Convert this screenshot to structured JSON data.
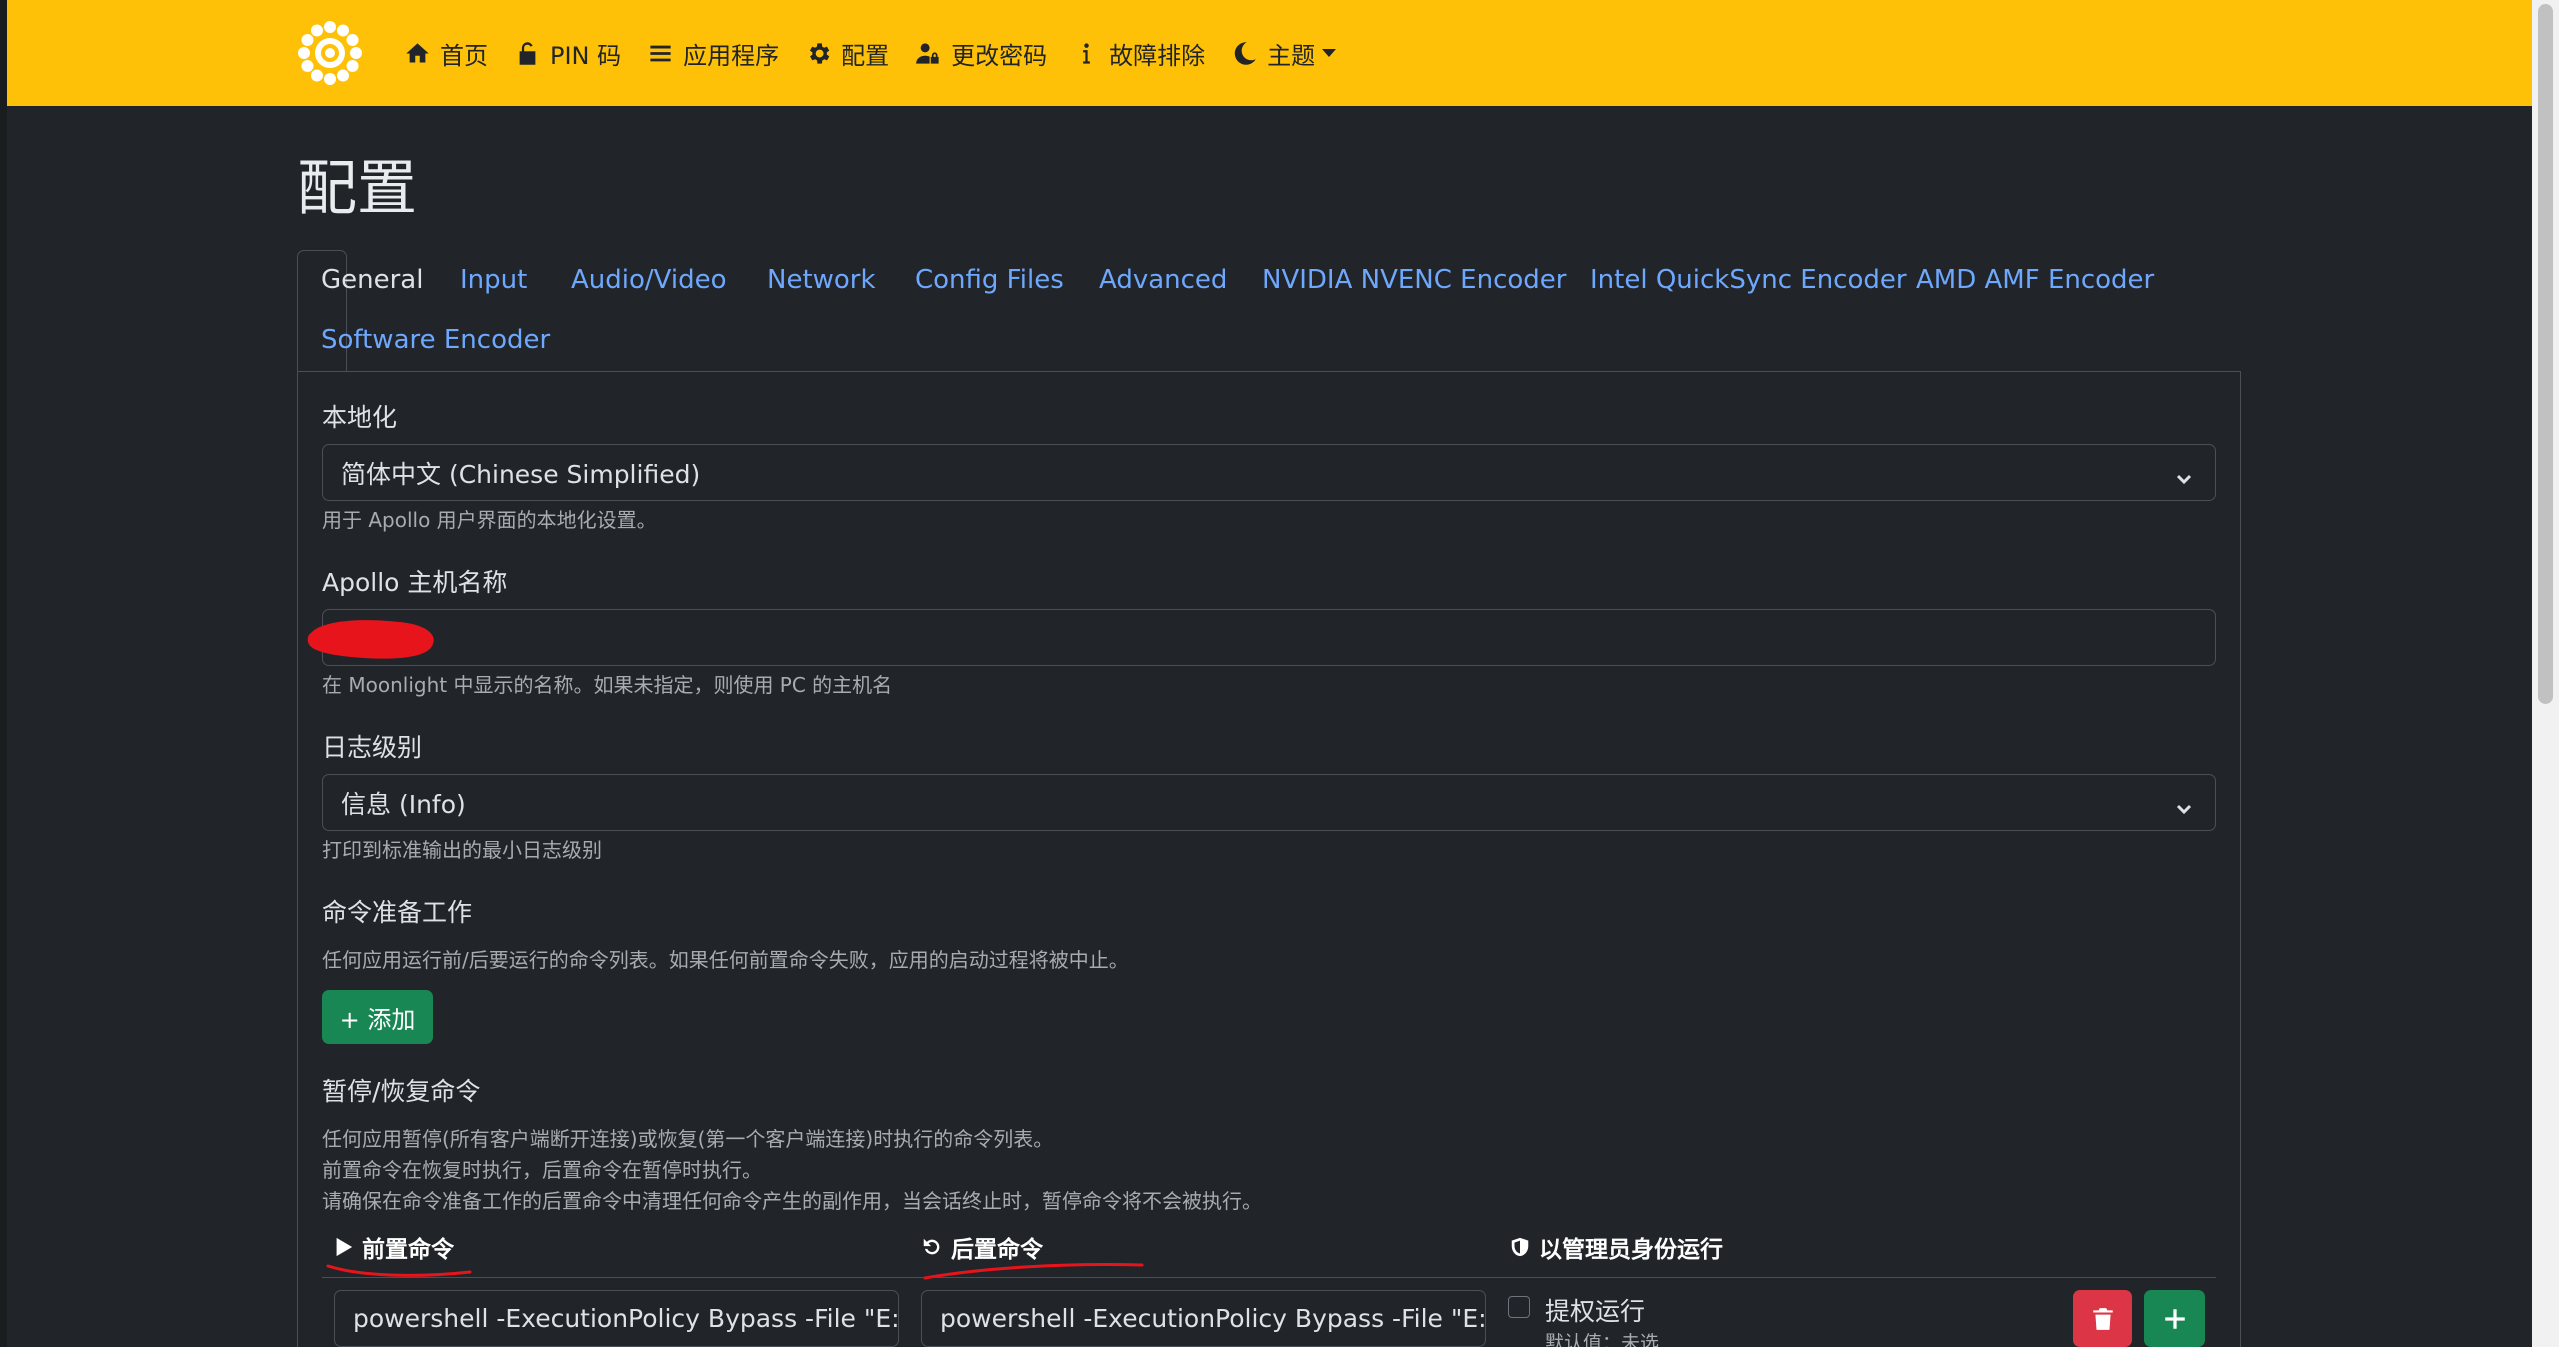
{
  "navbar": {
    "items": [
      {
        "label": "首页",
        "icon": "home-icon"
      },
      {
        "label": "PIN 码",
        "icon": "unlock-icon"
      },
      {
        "label": "应用程序",
        "icon": "list-icon"
      },
      {
        "label": "配置",
        "icon": "gear-icon"
      },
      {
        "label": "更改密码",
        "icon": "user-lock-icon"
      },
      {
        "label": "故障排除",
        "icon": "info-icon"
      },
      {
        "label": "主题",
        "icon": "moon-icon"
      }
    ],
    "bg_color": "#ffc107"
  },
  "page": {
    "title": "配置"
  },
  "tabs": [
    {
      "label": "General",
      "active": true
    },
    {
      "label": "Input"
    },
    {
      "label": "Audio/Video"
    },
    {
      "label": "Network"
    },
    {
      "label": "Config Files"
    },
    {
      "label": "Advanced"
    },
    {
      "label": "NVIDIA NVENC Encoder"
    },
    {
      "label": "Intel QuickSync Encoder"
    },
    {
      "label": "AMD AMF Encoder"
    },
    {
      "label": "Software Encoder"
    }
  ],
  "general": {
    "locale": {
      "label": "本地化",
      "value": "简体中文 (Chinese Simplified)",
      "help": "用于 Apollo 用户界面的本地化设置。"
    },
    "hostname": {
      "label": "Apollo 主机名称",
      "value": "",
      "help": "在 Moonlight 中显示的名称。如果未指定，则使用 PC 的主机名"
    },
    "log_level": {
      "label": "日志级别",
      "value": "信息 (Info)",
      "help": "打印到标准输出的最小日志级别"
    },
    "prep_cmd": {
      "label": "命令准备工作",
      "help": "任何应用运行前/后要运行的命令列表。如果任何前置命令失败，应用的启动过程将被中止。",
      "add_label": "+ 添加"
    },
    "state_cmd": {
      "label": "暂停/恢复命令",
      "help": [
        "任何应用暂停(所有客户端断开连接)或恢复(第一个客户端连接)时执行的命令列表。",
        "前置命令在恢复时执行，后置命令在暂停时执行。",
        "请确保在命令准备工作的后置命令中清理任何命令产生的副作用，当会话终止时，暂停命令将不会被执行。"
      ],
      "columns": {
        "do": "前置命令",
        "undo": "后置命令",
        "elevated": "以管理员身份运行"
      },
      "rows": [
        {
          "do": "powershell -ExecutionPolicy Bypass -File \"E:\\U",
          "undo": "powershell -ExecutionPolicy Bypass -File \"E:\\U",
          "elevated_label": "提权运行",
          "elevated_default": "默认值：未选"
        }
      ]
    }
  },
  "colors": {
    "accent_link": "#6ea8fe",
    "danger": "#dc3545",
    "success": "#198754",
    "background": "#212529",
    "annotation_red": "#e8141c"
  }
}
